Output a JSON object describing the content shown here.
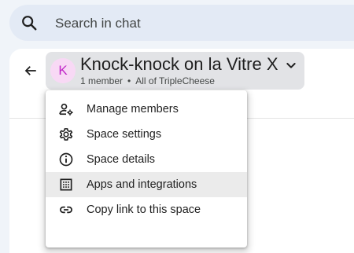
{
  "search": {
    "placeholder": "Search in chat",
    "icon": "search-icon"
  },
  "header": {
    "back_icon": "arrow-back-icon",
    "avatar_letter": "K",
    "avatar_color": "#c026c7",
    "avatar_bg": "#f8d9f5",
    "title": "Knock-knock on la Vitre X",
    "member_count": "1 member",
    "separator": "•",
    "audience": "All of TripleCheese",
    "dropdown_icon": "chevron-down-icon"
  },
  "menu": {
    "items": [
      {
        "label": "Manage members",
        "icon": "manage-members-icon"
      },
      {
        "label": "Space settings",
        "icon": "gear-icon"
      },
      {
        "label": "Space details",
        "icon": "info-icon"
      },
      {
        "label": "Apps and integrations",
        "icon": "apps-grid-icon",
        "highlighted": true
      },
      {
        "label": "Copy link to this space",
        "icon": "link-icon"
      }
    ]
  }
}
